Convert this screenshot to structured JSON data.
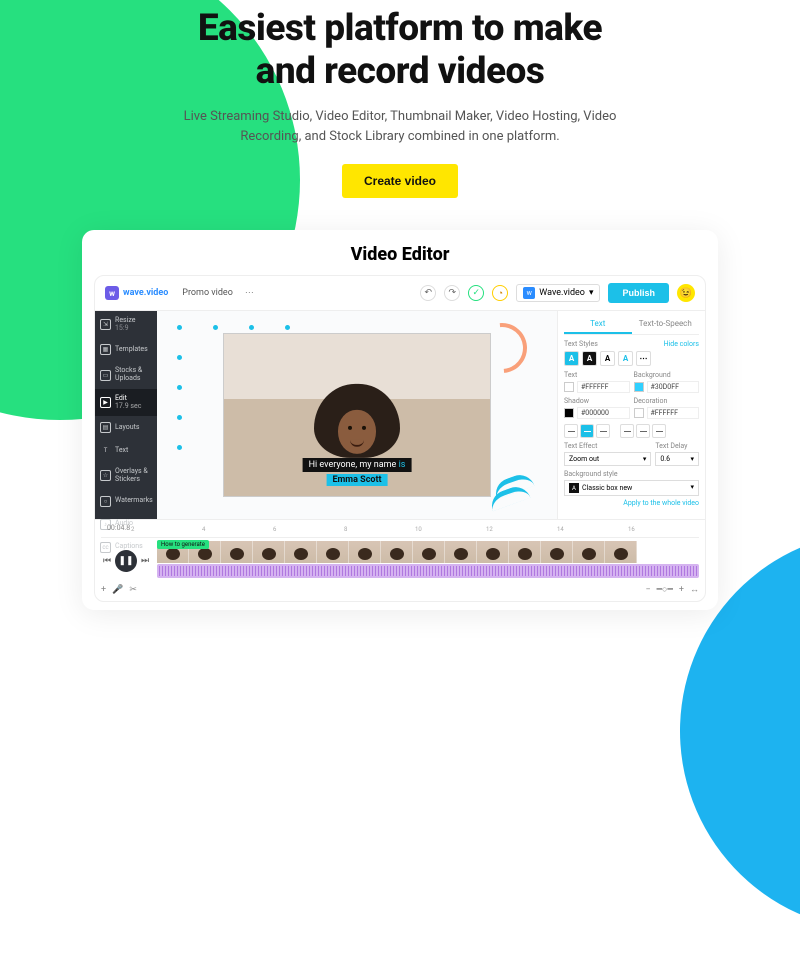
{
  "hero": {
    "title_l1": "Easiest platform to make",
    "title_l2": "and record videos",
    "subtitle": "Live Streaming Studio, Video Editor, Thumbnail Maker, Video Hosting, Video Recording, and Stock Library combined in one platform.",
    "cta": "Create video"
  },
  "editor": {
    "card_title": "Video Editor",
    "brand": "wave.video",
    "project_name": "Promo video",
    "workspace": "Wave.video",
    "publish": "Publish",
    "sidebar": [
      {
        "label": "Resize",
        "sub": "15:9"
      },
      {
        "label": "Templates"
      },
      {
        "label": "Stocks & Uploads"
      },
      {
        "label": "Edit",
        "sub": "17.9 sec",
        "active": true
      },
      {
        "label": "Layouts"
      },
      {
        "label": "Text"
      },
      {
        "label": "Overlays & Stickers"
      },
      {
        "label": "Watermarks"
      },
      {
        "label": "Audio"
      },
      {
        "label": "Captions"
      }
    ],
    "subtitle_line1_pre": "Hi everyone, my name ",
    "subtitle_line1_hl": "is",
    "subtitle_line2": "Emma Scott",
    "props": {
      "tab_text": "Text",
      "tab_tts": "Text-to-Speech",
      "text_styles": "Text Styles",
      "hide_colors": "Hide colors",
      "text_label": "Text",
      "bg_label": "Background",
      "text_hex": "#FFFFFF",
      "bg_hex": "#30D0FF",
      "shadow_label": "Shadow",
      "deco_label": "Decoration",
      "shadow_hex": "#000000",
      "deco_hex": "#FFFFFF",
      "effect_label": "Text Effect",
      "effect_val": "Zoom out",
      "delay_label": "Text Delay",
      "delay_val": "0.6",
      "bgstyle_label": "Background style",
      "bgstyle_val": "Classic box new",
      "apply_all": "Apply to the whole video"
    },
    "timeline": {
      "timecode": "00:04.8",
      "ticks": [
        "2",
        "4",
        "6",
        "8",
        "10",
        "12",
        "14",
        "16"
      ],
      "clip_label": "How to generate"
    }
  }
}
